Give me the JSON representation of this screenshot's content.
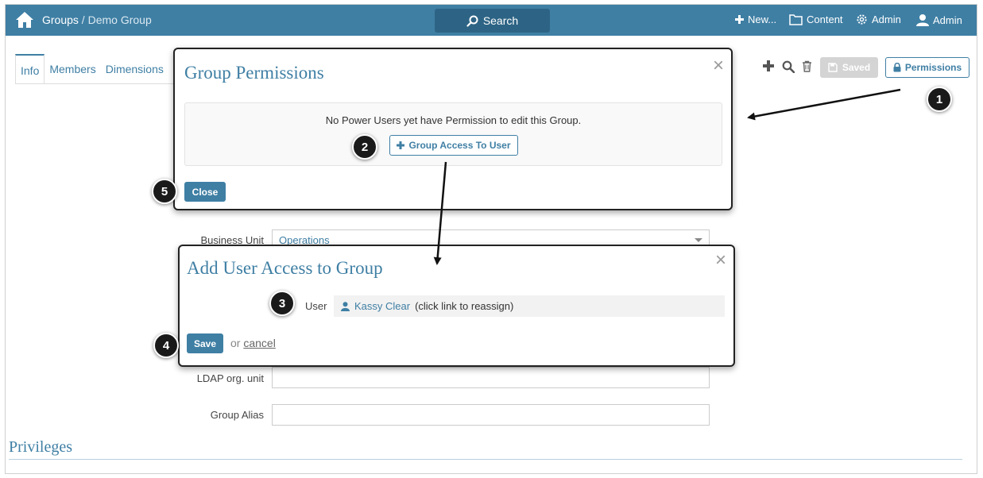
{
  "topbar": {
    "breadcrumb_root": "Groups",
    "breadcrumb_sep": " / ",
    "breadcrumb_current": "Demo Group",
    "search_label": "Search",
    "new_label": "New...",
    "content_label": "Content",
    "admin_menu_label": "Admin",
    "user_label": "Admin",
    "bg_color": "#3f7fa4"
  },
  "tabs": [
    {
      "label": "Info",
      "active": true
    },
    {
      "label": "Members",
      "active": false
    },
    {
      "label": "Dimensions",
      "active": false
    }
  ],
  "toolbar": {
    "saved_label": "Saved",
    "permissions_label": "Permissions"
  },
  "form": {
    "business_unit_label": "Business Unit",
    "business_unit_value": "Operations",
    "ldap_label": "LDAP org. unit",
    "ldap_value": "",
    "alias_label": "Group Alias",
    "alias_value": ""
  },
  "section": {
    "privileges_title": "Privileges"
  },
  "group_permissions_modal": {
    "title": "Group Permissions",
    "close_icon": "×",
    "message": "No Power Users yet have Permission to edit this Group.",
    "grant_button": "Group Access To User",
    "close_button": "Close"
  },
  "add_user_modal": {
    "title": "Add User Access to Group",
    "close_icon": "×",
    "user_label": "User",
    "user_name": "Kassy Clear",
    "user_hint": "(click link to reassign)",
    "save_button": "Save",
    "or_text": "or",
    "cancel_link": "cancel"
  },
  "callouts": [
    "1",
    "2",
    "3",
    "4",
    "5"
  ]
}
